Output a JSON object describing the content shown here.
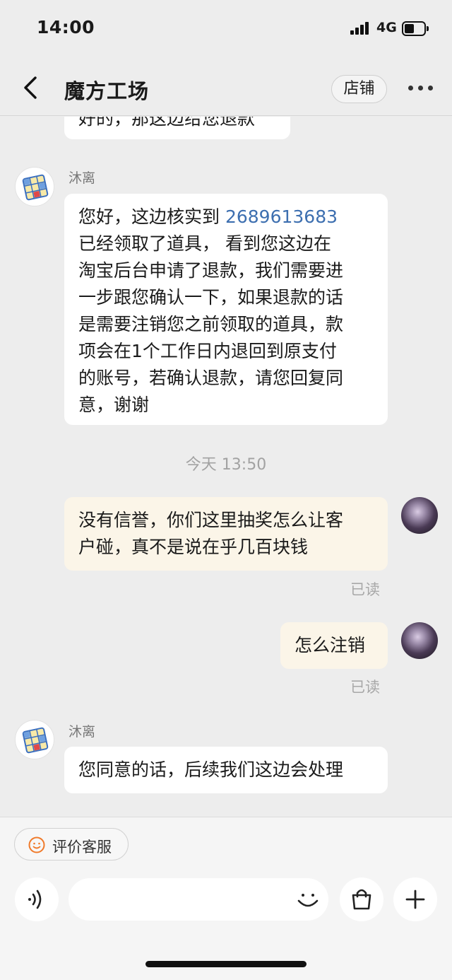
{
  "status_bar": {
    "time": "14:00",
    "network": "4G"
  },
  "header": {
    "title": "魔方工场",
    "shop_label": "店铺"
  },
  "chat": {
    "partial_message": "好的，那这边给您退款",
    "messages": [
      {
        "sender": "沐离",
        "lines": [
          {
            "pre": "您好，这边核实到 ",
            "number": "2689613683"
          },
          {
            "text": "已经领取了道具， 看到您这边在"
          },
          {
            "text": "淘宝后台申请了退款，我们需要进"
          },
          {
            "text": "一步跟您确认一下，如果退款的话"
          },
          {
            "text": "是需要注销您之前领取的道具，款"
          },
          {
            "text": "项会在1个工作日内退回到原支付"
          },
          {
            "text": "的账号，若确认退款，请您回复同"
          },
          {
            "text": "意，谢谢"
          }
        ]
      }
    ],
    "timestamp": "今天 13:50",
    "user_messages": [
      {
        "lines": [
          "没有信誉，你们这里抽奖怎么让客",
          "户碰，真不是说在乎几百块钱"
        ],
        "status": "已读"
      },
      {
        "lines": [
          "怎么注销"
        ],
        "status": "已读"
      }
    ],
    "last_message": {
      "sender": "沐离",
      "text": "您同意的话，后续我们这边会处理"
    }
  },
  "footer": {
    "rate_label": "评价客服"
  }
}
